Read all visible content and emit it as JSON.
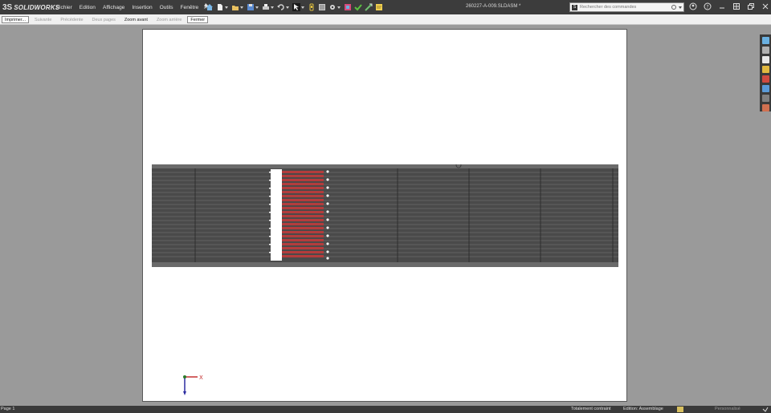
{
  "titlebar": {
    "brand_prefix": "3S",
    "brand": "SOLIDWORKS",
    "menu": [
      "Fichier",
      "Edition",
      "Affichage",
      "Insertion",
      "Outils",
      "Fenêtre"
    ],
    "document_title": "260227-A-009.SLDASM *",
    "search_placeholder": "Rechercher des commandes"
  },
  "print_toolbar": {
    "print": "Imprimer...",
    "next": "Suivante",
    "previous": "Précédente",
    "two_pages": "Deux pages",
    "zoom_in": "Zoom avant",
    "zoom_out": "Zoom arrière",
    "close": "Fermer"
  },
  "triad": {
    "x_label": "X"
  },
  "statusbar": {
    "page": "Page 1",
    "constraint": "Totalement contraint",
    "edit_mode": "Edition: Assemblage",
    "custom": "Personnalisé"
  },
  "colors": {
    "accent_red": "#b43c3c",
    "drawing_dark": "#4a4a4a",
    "drawing_stripe": "#7a7a7a",
    "triad_x": "#c43030",
    "triad_y": "#2a7a2a",
    "triad_z": "#2a2aa0"
  }
}
